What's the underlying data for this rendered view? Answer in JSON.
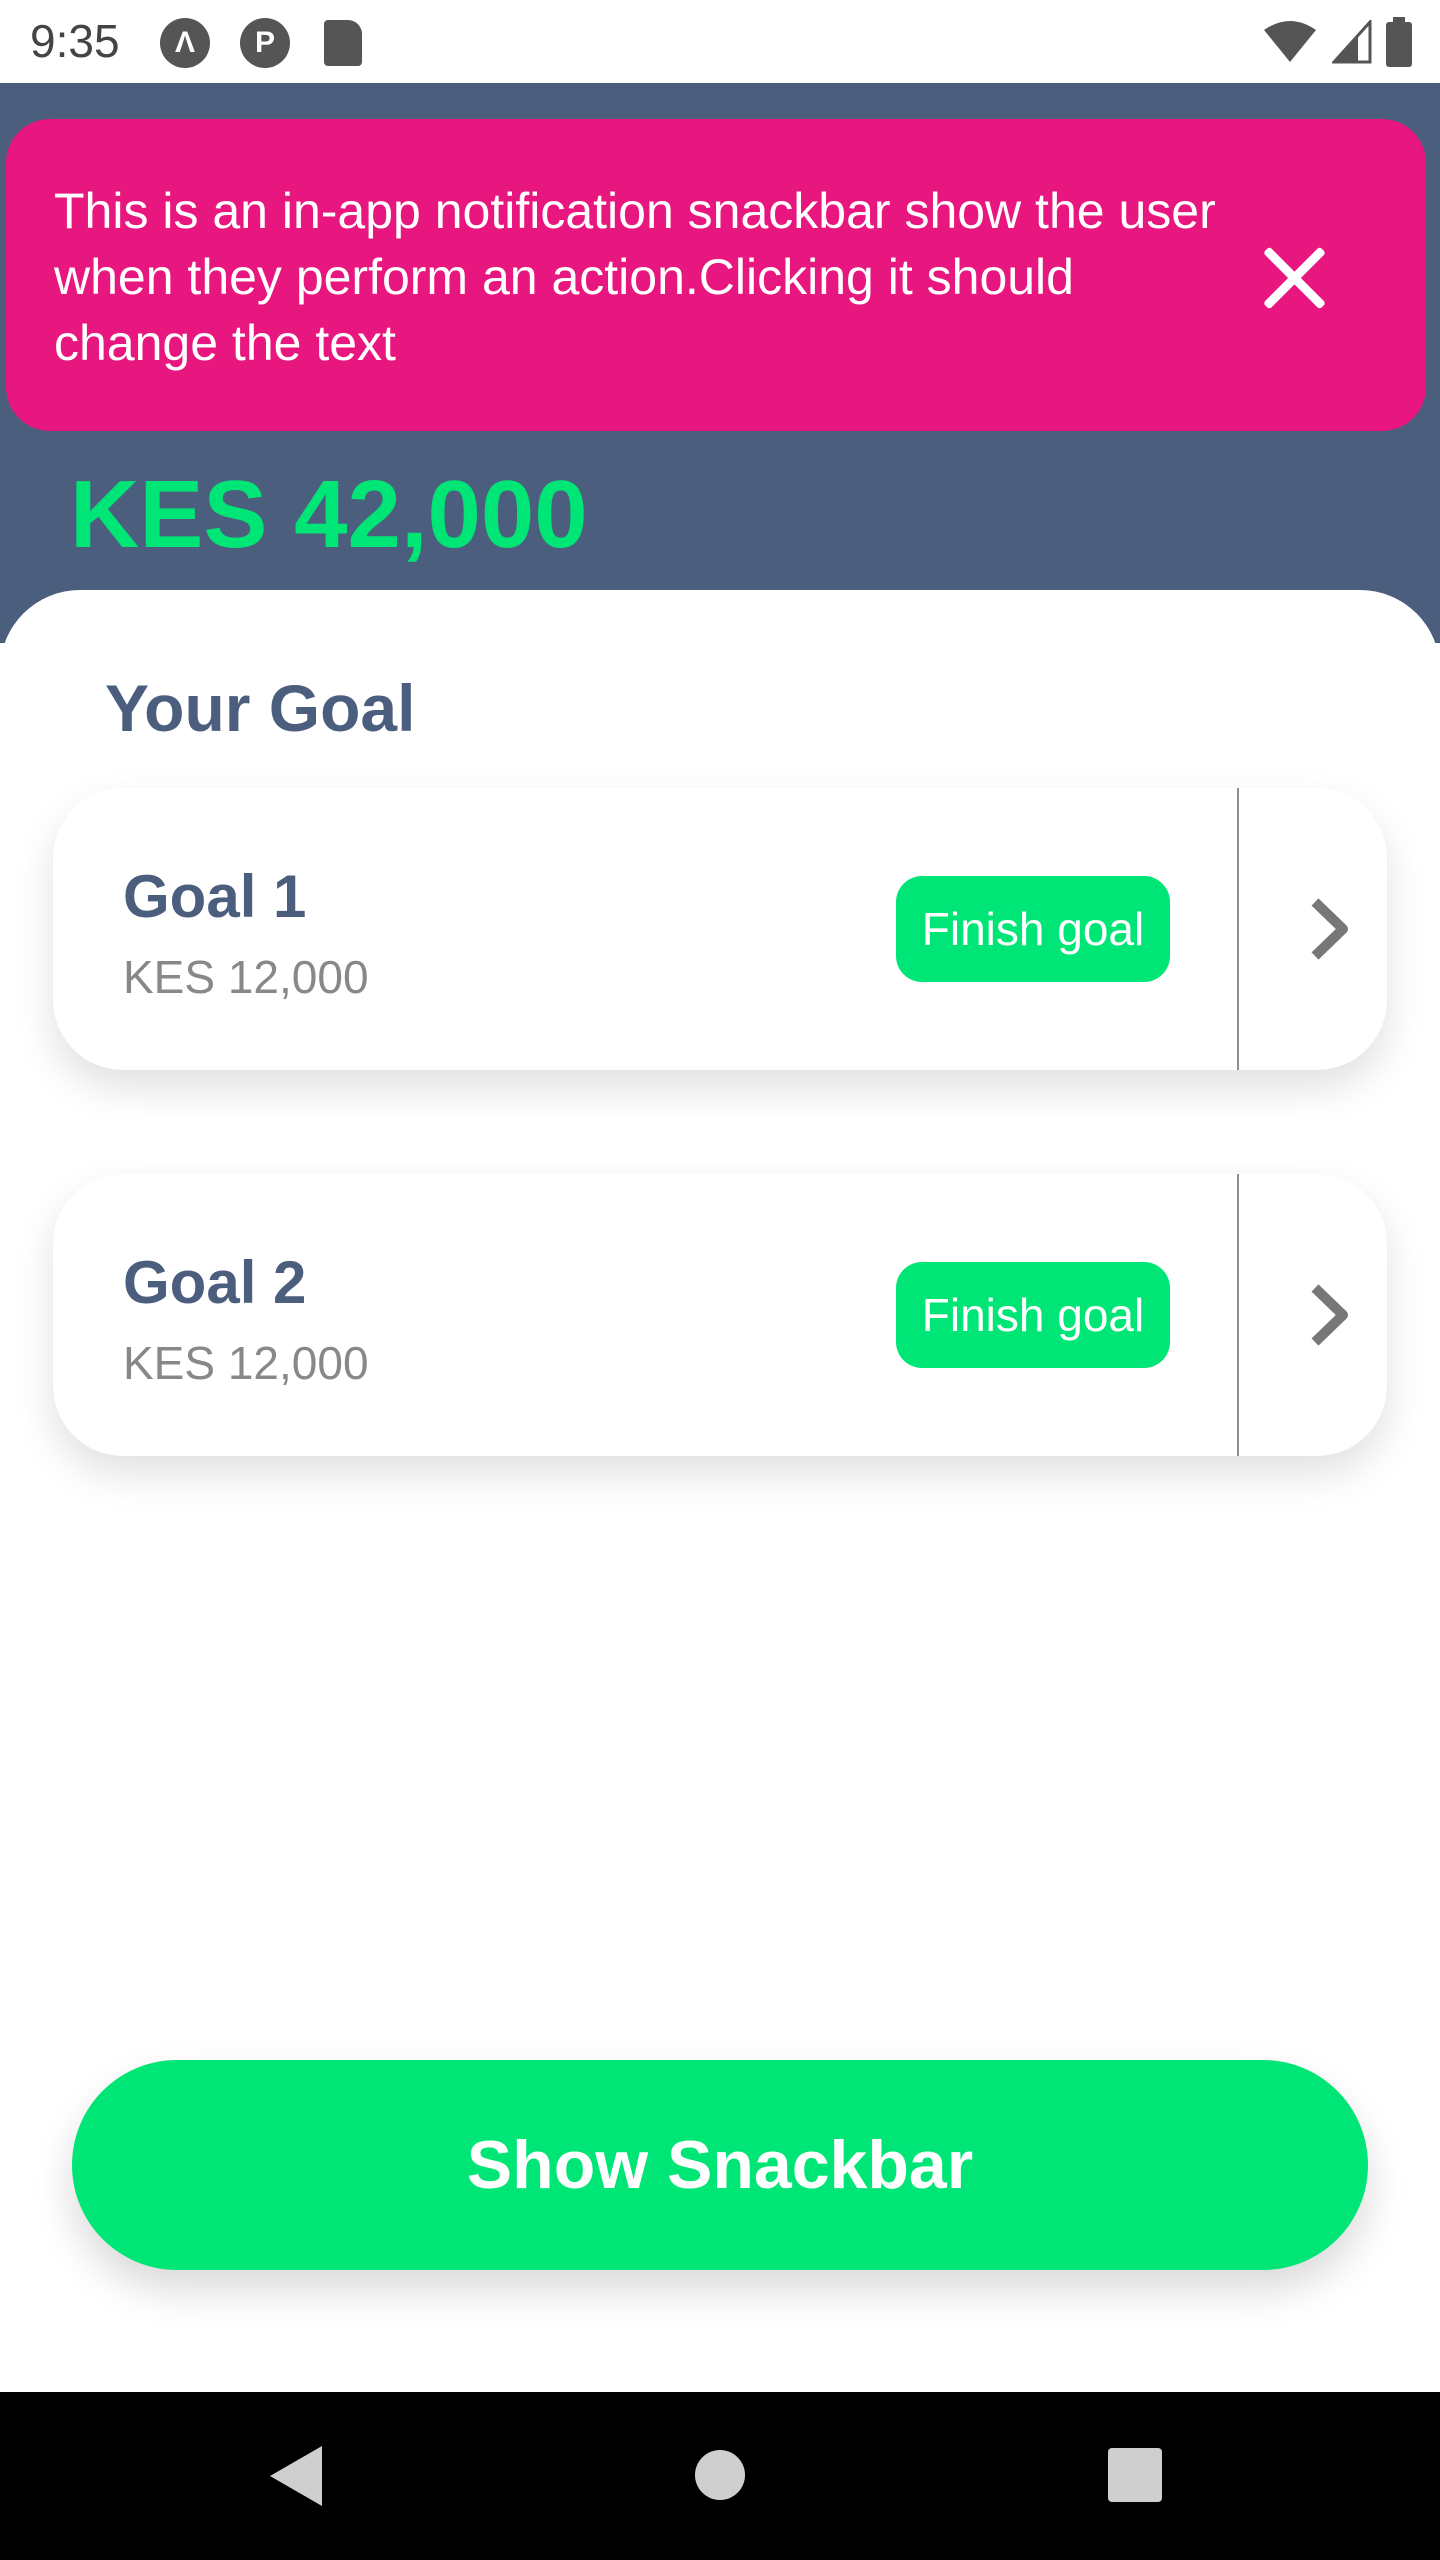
{
  "status_bar": {
    "time": "9:35",
    "icons": [
      "a-circle-icon",
      "p-circle-icon",
      "sd-card-icon",
      "wifi-icon",
      "signal-icon",
      "battery-icon"
    ]
  },
  "header": {
    "balance": "KES 42,000"
  },
  "snackbar": {
    "message": "This is an in-app notification snackbar show the user when they perform an action.Clicking it should change the text",
    "close_icon": "close-icon"
  },
  "goals": {
    "title": "Your Goal",
    "items": [
      {
        "name": "Goal 1",
        "amount": "KES 12,000",
        "action_label": "Finish goal"
      },
      {
        "name": "Goal 2",
        "amount": "KES 12,000",
        "action_label": "Finish goal"
      }
    ]
  },
  "actions": {
    "show_snackbar_label": "Show Snackbar"
  },
  "colors": {
    "header_bg": "#4b5e7e",
    "accent_green": "#00e676",
    "snackbar_pink": "#e8177f",
    "text_primary": "#4b5e7e"
  }
}
